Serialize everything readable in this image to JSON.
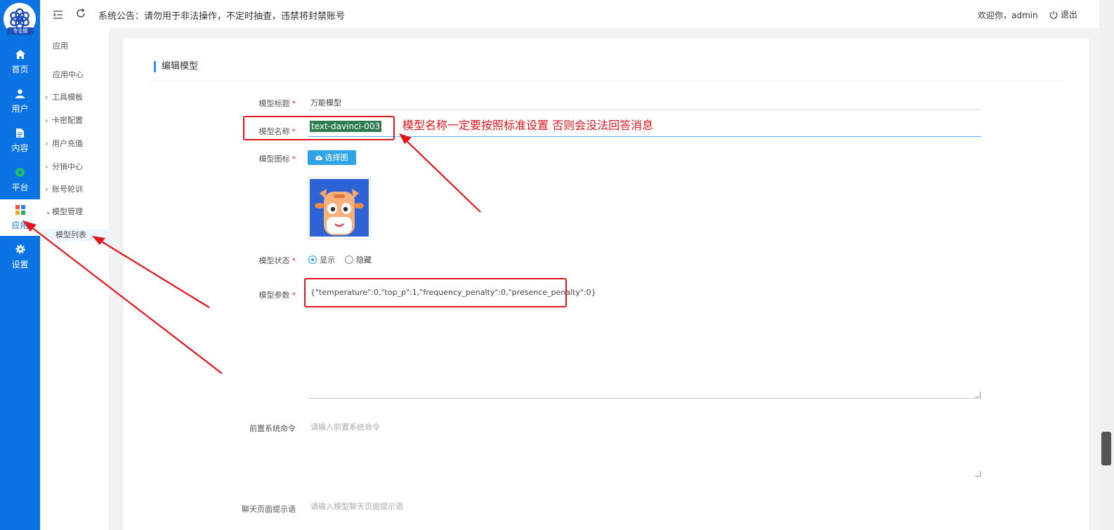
{
  "rail": {
    "badge": "专业版",
    "items": [
      {
        "label": "首页",
        "icon": "home-icon"
      },
      {
        "label": "用户",
        "icon": "user-icon"
      },
      {
        "label": "内容",
        "icon": "document-icon"
      },
      {
        "label": "平台",
        "icon": "platform-icon"
      },
      {
        "label": "应用",
        "icon": "apps-icon",
        "active": true
      },
      {
        "label": "设置",
        "icon": "gear-icon"
      }
    ]
  },
  "subnav": {
    "section_title": "应用",
    "items": [
      {
        "label": "应用中心"
      },
      {
        "label": "工具模板",
        "chevron": "›"
      },
      {
        "label": "卡密配置",
        "chevron": "›"
      },
      {
        "label": "用户充值",
        "chevron": "›"
      },
      {
        "label": "分销中心",
        "chevron": "›"
      },
      {
        "label": "账号轮训",
        "chevron": "›"
      },
      {
        "label": "模型管理",
        "chevron": "⌄"
      },
      {
        "label": "模型列表",
        "active": true
      }
    ]
  },
  "topbar": {
    "menu_icon": "menu-toggle-icon",
    "refresh_icon": "refresh-icon",
    "notice": "系统公告：请勿用于非法操作，不定时抽查，违禁将封禁账号",
    "welcome": "欢迎你，admin",
    "logout": "退出"
  },
  "form": {
    "title": "编辑模型",
    "model_title_label": "模型标题",
    "model_title_value": "万能模型",
    "model_name_label": "模型名称",
    "model_name_value": "text-davinci-003",
    "model_icon_label": "模型图标",
    "choose_icon_button": "选择图标",
    "model_status_label": "模型状态",
    "status_options": [
      "显示",
      "隐藏"
    ],
    "status_selected": "显示",
    "model_params_label": "模型参数",
    "model_params_value": "{\"temperature\":0,\"top_p\":1,\"frequency_penalty\":0,\"presence_penalty\":0}",
    "system_prompt_label": "前置系统命令",
    "system_prompt_placeholder": "请输入前置系统命令",
    "chat_tip_label": "聊天页面提示语",
    "chat_tip_placeholder": "请输入模型聊天页面提示语"
  },
  "annotation": {
    "text": "模型名称一定要按照标准设置  否则会没法回答消息",
    "color": "#e4151c"
  },
  "colors": {
    "rail": "#0b74e5",
    "accent": "#1e9fff",
    "button": "#2fa4e7"
  }
}
